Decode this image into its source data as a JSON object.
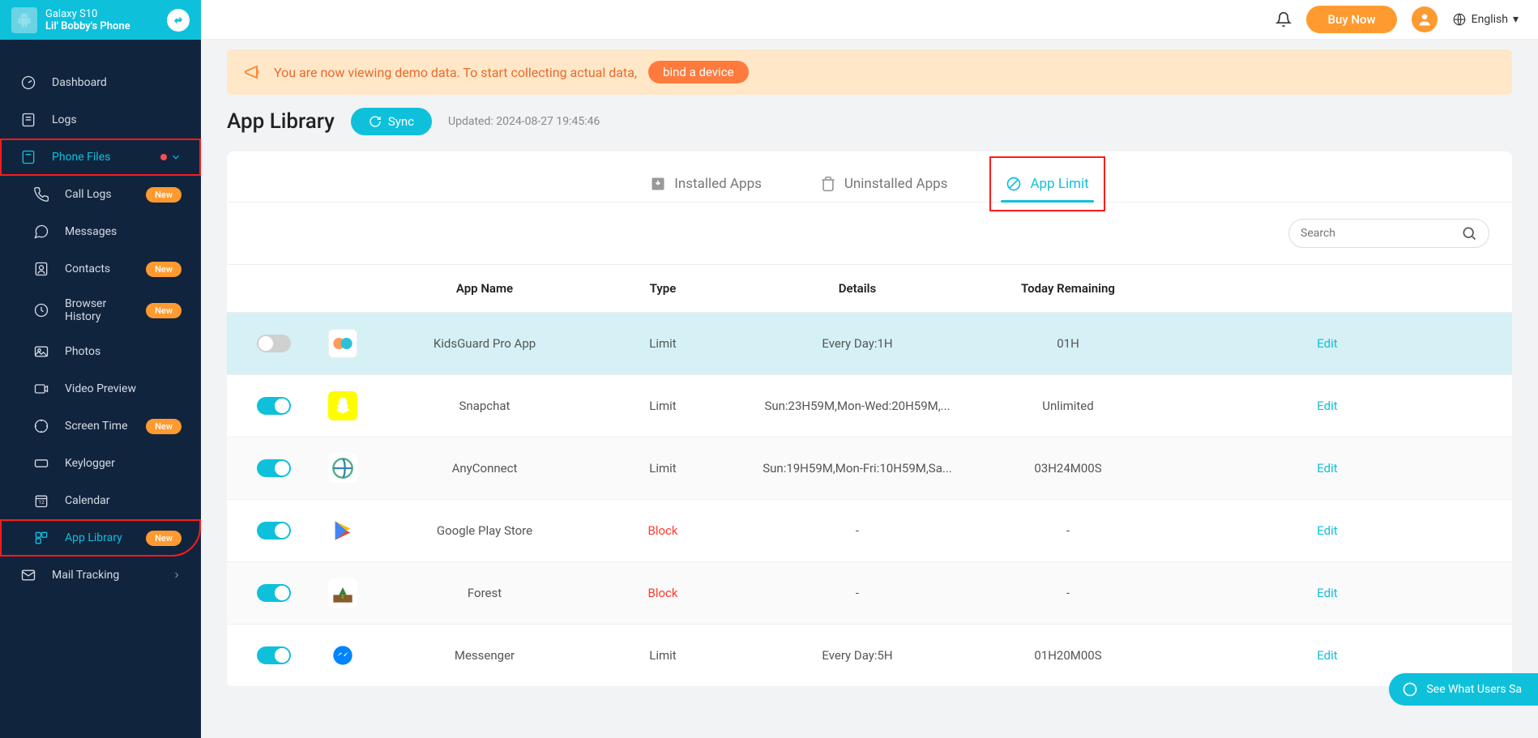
{
  "device": {
    "model": "Galaxy S10",
    "owner": "Lil' Bobby's Phone"
  },
  "topbar": {
    "buy_now": "Buy Now",
    "language": "English"
  },
  "demo": {
    "text": "You are now viewing demo data. To start collecting actual data,",
    "bind": "bind a device"
  },
  "page": {
    "title": "App Library",
    "sync": "Sync",
    "updated": "Updated: 2024-08-27 19:45:46"
  },
  "sidebar": {
    "dashboard": "Dashboard",
    "logs": "Logs",
    "phone_files": "Phone Files",
    "call_logs": "Call Logs",
    "messages": "Messages",
    "contacts": "Contacts",
    "browser_history": "Browser History",
    "photos": "Photos",
    "video_preview": "Video Preview",
    "screen_time": "Screen Time",
    "keylogger": "Keylogger",
    "calendar": "Calendar",
    "app_library": "App Library",
    "mail_tracking": "Mail Tracking",
    "new_badge": "New"
  },
  "tabs": {
    "installed": "Installed Apps",
    "uninstalled": "Uninstalled Apps",
    "limit": "App Limit"
  },
  "search": {
    "placeholder": "Search"
  },
  "columns": {
    "name": "App Name",
    "type": "Type",
    "details": "Details",
    "remaining": "Today Remaining"
  },
  "edit_label": "Edit",
  "rows": [
    {
      "toggle": false,
      "icon": "kidsguard",
      "name": "KidsGuard Pro App",
      "type": "Limit",
      "type_block": false,
      "details": "Every Day:1H",
      "remaining": "01H",
      "highlight": true
    },
    {
      "toggle": true,
      "icon": "snapchat",
      "name": "Snapchat",
      "type": "Limit",
      "type_block": false,
      "details": "Sun:23H59M,Mon-Wed:20H59M,...",
      "remaining": "Unlimited",
      "highlight": false
    },
    {
      "toggle": true,
      "icon": "anyconnect",
      "name": "AnyConnect",
      "type": "Limit",
      "type_block": false,
      "details": "Sun:19H59M,Mon-Fri:10H59M,Sa...",
      "remaining": "03H24M00S",
      "highlight": false
    },
    {
      "toggle": true,
      "icon": "playstore",
      "name": "Google Play Store",
      "type": "Block",
      "type_block": true,
      "details": "-",
      "remaining": "-",
      "highlight": false
    },
    {
      "toggle": true,
      "icon": "forest",
      "name": "Forest",
      "type": "Block",
      "type_block": true,
      "details": "-",
      "remaining": "-",
      "highlight": false
    },
    {
      "toggle": true,
      "icon": "messenger",
      "name": "Messenger",
      "type": "Limit",
      "type_block": false,
      "details": "Every Day:5H",
      "remaining": "01H20M00S",
      "highlight": false
    }
  ],
  "float": {
    "label": "See What Users Sa"
  }
}
